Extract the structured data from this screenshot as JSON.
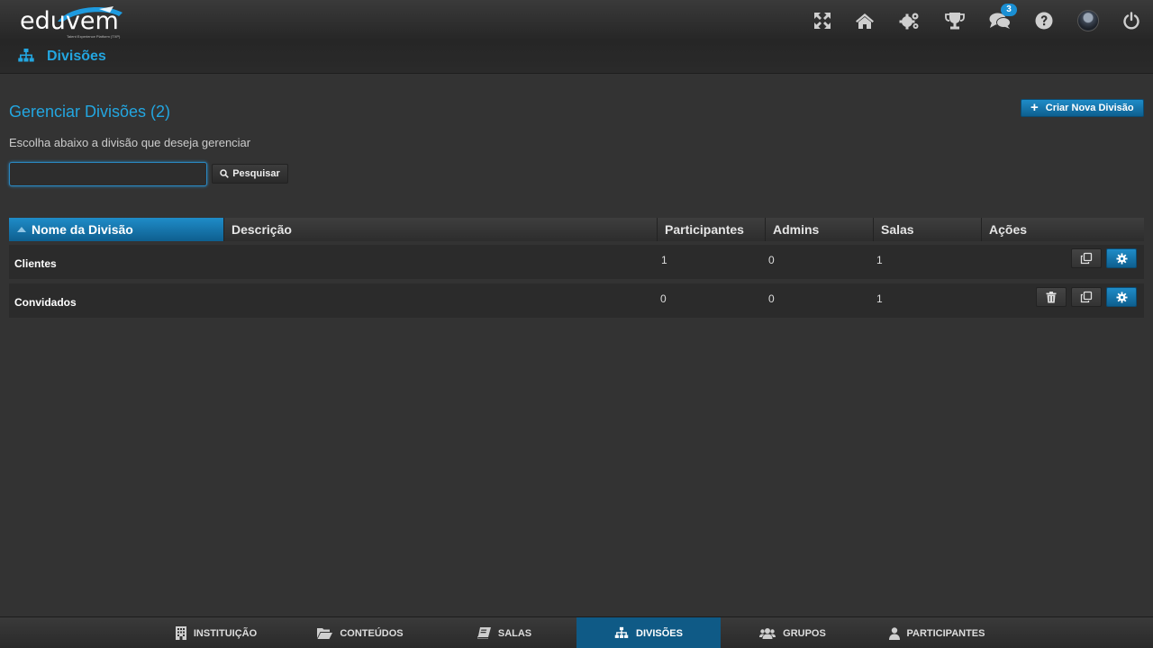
{
  "app": {
    "logo_text": "eduvem",
    "logo_tagline": "Talent Experience Platform (TXP)"
  },
  "header": {
    "icons": [
      "fullscreen-icon",
      "home-icon",
      "gears-icon",
      "trophy-icon",
      "chat-icon",
      "help-icon",
      "avatar",
      "power-icon"
    ],
    "chat_badge": "3"
  },
  "subheader": {
    "title": "Divisões"
  },
  "main": {
    "title": "Gerenciar Divisões (2)",
    "create_label": "Criar Nova Divisão",
    "subtitle": "Escolha abaixo a divisão que deseja gerenciar",
    "search_value": "",
    "search_label": "Pesquisar"
  },
  "table": {
    "columns": [
      "Nome da Divisão",
      "Descrição",
      "Participantes",
      "Admins",
      "Salas",
      "Ações"
    ],
    "rows": [
      {
        "name": "Clientes",
        "description": "",
        "participants": "1",
        "admins": "0",
        "rooms": "1",
        "actions": [
          "copy",
          "settings"
        ]
      },
      {
        "name": "Convidados",
        "description": "",
        "participants": "0",
        "admins": "0",
        "rooms": "1",
        "actions": [
          "delete",
          "copy",
          "settings"
        ]
      }
    ]
  },
  "bottom_nav": {
    "items": [
      {
        "label": "INSTITUIÇÃO",
        "icon": "building-icon"
      },
      {
        "label": "CONTEÚDOS",
        "icon": "folder-icon"
      },
      {
        "label": "SALAS",
        "icon": "book-icon"
      },
      {
        "label": "DIVISÕES",
        "icon": "sitemap-icon"
      },
      {
        "label": "GRUPOS",
        "icon": "users-icon"
      },
      {
        "label": "PARTICIPANTES",
        "icon": "user-icon"
      }
    ],
    "active": "DIVISÕES"
  },
  "colors": {
    "accent": "#23a6e0",
    "button_blue": "#1a7fb8",
    "background": "#333333"
  }
}
